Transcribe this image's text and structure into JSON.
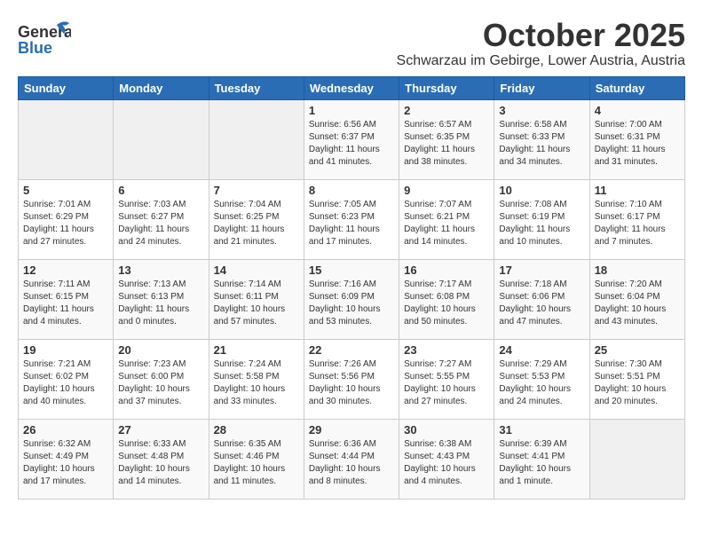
{
  "header": {
    "logo_general": "General",
    "logo_blue": "Blue",
    "month": "October 2025",
    "location": "Schwarzau im Gebirge, Lower Austria, Austria"
  },
  "weekdays": [
    "Sunday",
    "Monday",
    "Tuesday",
    "Wednesday",
    "Thursday",
    "Friday",
    "Saturday"
  ],
  "weeks": [
    [
      {
        "day": "",
        "text": ""
      },
      {
        "day": "",
        "text": ""
      },
      {
        "day": "",
        "text": ""
      },
      {
        "day": "1",
        "text": "Sunrise: 6:56 AM\nSunset: 6:37 PM\nDaylight: 11 hours\nand 41 minutes."
      },
      {
        "day": "2",
        "text": "Sunrise: 6:57 AM\nSunset: 6:35 PM\nDaylight: 11 hours\nand 38 minutes."
      },
      {
        "day": "3",
        "text": "Sunrise: 6:58 AM\nSunset: 6:33 PM\nDaylight: 11 hours\nand 34 minutes."
      },
      {
        "day": "4",
        "text": "Sunrise: 7:00 AM\nSunset: 6:31 PM\nDaylight: 11 hours\nand 31 minutes."
      }
    ],
    [
      {
        "day": "5",
        "text": "Sunrise: 7:01 AM\nSunset: 6:29 PM\nDaylight: 11 hours\nand 27 minutes."
      },
      {
        "day": "6",
        "text": "Sunrise: 7:03 AM\nSunset: 6:27 PM\nDaylight: 11 hours\nand 24 minutes."
      },
      {
        "day": "7",
        "text": "Sunrise: 7:04 AM\nSunset: 6:25 PM\nDaylight: 11 hours\nand 21 minutes."
      },
      {
        "day": "8",
        "text": "Sunrise: 7:05 AM\nSunset: 6:23 PM\nDaylight: 11 hours\nand 17 minutes."
      },
      {
        "day": "9",
        "text": "Sunrise: 7:07 AM\nSunset: 6:21 PM\nDaylight: 11 hours\nand 14 minutes."
      },
      {
        "day": "10",
        "text": "Sunrise: 7:08 AM\nSunset: 6:19 PM\nDaylight: 11 hours\nand 10 minutes."
      },
      {
        "day": "11",
        "text": "Sunrise: 7:10 AM\nSunset: 6:17 PM\nDaylight: 11 hours\nand 7 minutes."
      }
    ],
    [
      {
        "day": "12",
        "text": "Sunrise: 7:11 AM\nSunset: 6:15 PM\nDaylight: 11 hours\nand 4 minutes."
      },
      {
        "day": "13",
        "text": "Sunrise: 7:13 AM\nSunset: 6:13 PM\nDaylight: 11 hours\nand 0 minutes."
      },
      {
        "day": "14",
        "text": "Sunrise: 7:14 AM\nSunset: 6:11 PM\nDaylight: 10 hours\nand 57 minutes."
      },
      {
        "day": "15",
        "text": "Sunrise: 7:16 AM\nSunset: 6:09 PM\nDaylight: 10 hours\nand 53 minutes."
      },
      {
        "day": "16",
        "text": "Sunrise: 7:17 AM\nSunset: 6:08 PM\nDaylight: 10 hours\nand 50 minutes."
      },
      {
        "day": "17",
        "text": "Sunrise: 7:18 AM\nSunset: 6:06 PM\nDaylight: 10 hours\nand 47 minutes."
      },
      {
        "day": "18",
        "text": "Sunrise: 7:20 AM\nSunset: 6:04 PM\nDaylight: 10 hours\nand 43 minutes."
      }
    ],
    [
      {
        "day": "19",
        "text": "Sunrise: 7:21 AM\nSunset: 6:02 PM\nDaylight: 10 hours\nand 40 minutes."
      },
      {
        "day": "20",
        "text": "Sunrise: 7:23 AM\nSunset: 6:00 PM\nDaylight: 10 hours\nand 37 minutes."
      },
      {
        "day": "21",
        "text": "Sunrise: 7:24 AM\nSunset: 5:58 PM\nDaylight: 10 hours\nand 33 minutes."
      },
      {
        "day": "22",
        "text": "Sunrise: 7:26 AM\nSunset: 5:56 PM\nDaylight: 10 hours\nand 30 minutes."
      },
      {
        "day": "23",
        "text": "Sunrise: 7:27 AM\nSunset: 5:55 PM\nDaylight: 10 hours\nand 27 minutes."
      },
      {
        "day": "24",
        "text": "Sunrise: 7:29 AM\nSunset: 5:53 PM\nDaylight: 10 hours\nand 24 minutes."
      },
      {
        "day": "25",
        "text": "Sunrise: 7:30 AM\nSunset: 5:51 PM\nDaylight: 10 hours\nand 20 minutes."
      }
    ],
    [
      {
        "day": "26",
        "text": "Sunrise: 6:32 AM\nSunset: 4:49 PM\nDaylight: 10 hours\nand 17 minutes."
      },
      {
        "day": "27",
        "text": "Sunrise: 6:33 AM\nSunset: 4:48 PM\nDaylight: 10 hours\nand 14 minutes."
      },
      {
        "day": "28",
        "text": "Sunrise: 6:35 AM\nSunset: 4:46 PM\nDaylight: 10 hours\nand 11 minutes."
      },
      {
        "day": "29",
        "text": "Sunrise: 6:36 AM\nSunset: 4:44 PM\nDaylight: 10 hours\nand 8 minutes."
      },
      {
        "day": "30",
        "text": "Sunrise: 6:38 AM\nSunset: 4:43 PM\nDaylight: 10 hours\nand 4 minutes."
      },
      {
        "day": "31",
        "text": "Sunrise: 6:39 AM\nSunset: 4:41 PM\nDaylight: 10 hours\nand 1 minute."
      },
      {
        "day": "",
        "text": ""
      }
    ]
  ]
}
